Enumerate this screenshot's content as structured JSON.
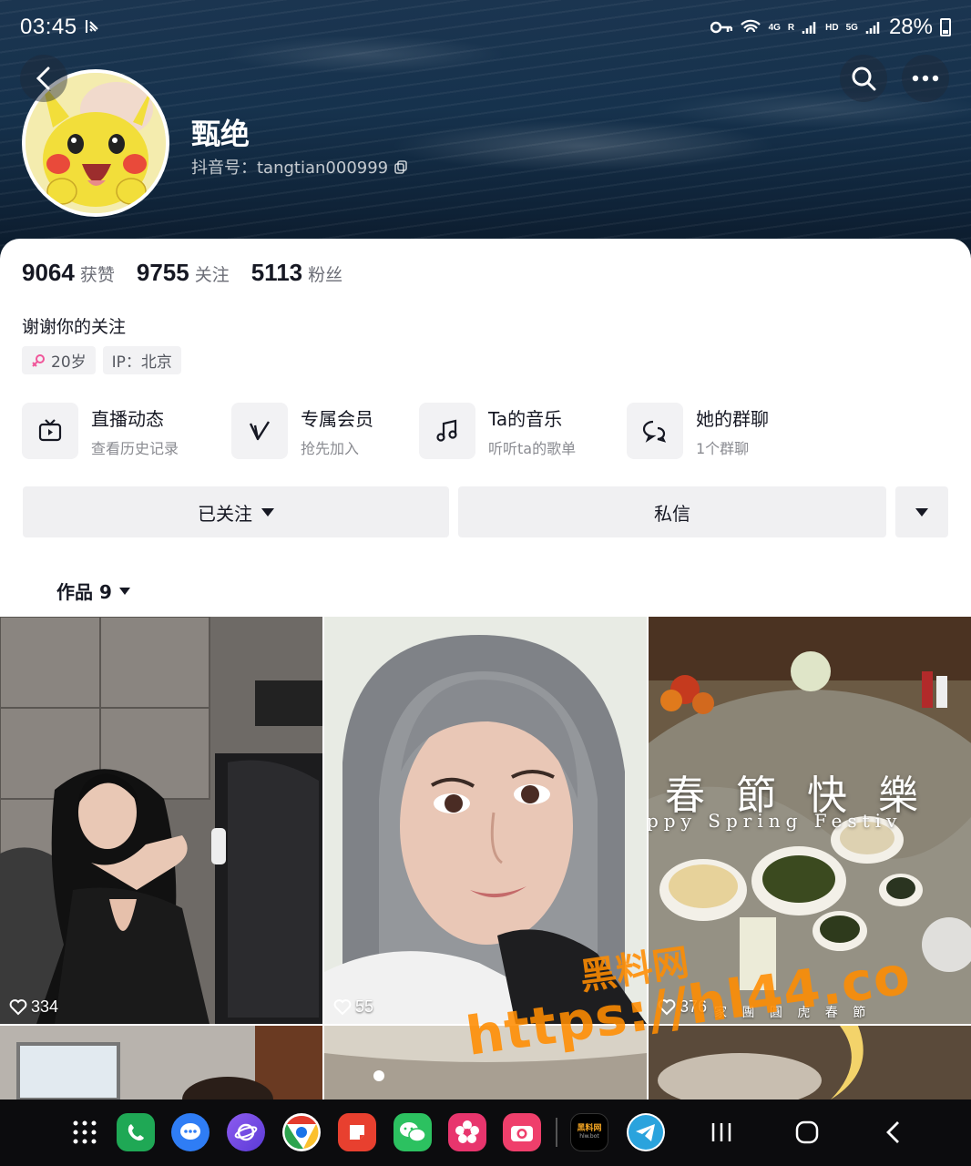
{
  "status_bar": {
    "time": "03:45",
    "network_4g": "4G",
    "roaming": "R",
    "hd": "HD",
    "network_5g": "5G",
    "battery": "28%"
  },
  "profile": {
    "nickname": "甄绝",
    "douyin_id": "抖音号：tangtian000999",
    "bio": "谢谢你的关注",
    "tags": [
      {
        "icon": "female-icon",
        "label": "20岁"
      },
      {
        "label": "IP：北京"
      }
    ]
  },
  "stats": [
    {
      "num": "9064",
      "label": "获赞"
    },
    {
      "num": "9755",
      "label": "关注"
    },
    {
      "num": "5113",
      "label": "粉丝"
    }
  ],
  "features": [
    {
      "icon": "live-tv-icon",
      "title": "直播动态",
      "sub": "查看历史记录"
    },
    {
      "icon": "vip-v-icon",
      "title": "专属会员",
      "sub": "抢先加入"
    },
    {
      "icon": "music-note-icon",
      "title": "Ta的音乐",
      "sub": "听听ta的歌单"
    },
    {
      "icon": "group-chat-icon",
      "title": "她的群聊",
      "sub": "1个群聊"
    }
  ],
  "actions": {
    "followed": "已关注",
    "message": "私信"
  },
  "works_tab": "作品 9",
  "videos": [
    {
      "likes": "334"
    },
    {
      "likes": "55"
    },
    {
      "likes": "376",
      "overlay_title": "春 節 快 樂",
      "overlay_sub": "ppy Spring Festiv",
      "overlay_bottom": "家 團 圓 虎 春 節"
    }
  ],
  "watermark": {
    "line1": "黑料网",
    "line2": "https://hl44.co"
  },
  "dock": {
    "apps": [
      "apps-grid-icon",
      "phone-icon",
      "messages-icon",
      "internet-icon",
      "chrome-icon",
      "notes-icon",
      "wechat-icon",
      "flower-icon",
      "camera-icon",
      "heiliao-icon",
      "telegram-icon"
    ],
    "heiliao_label": "黑料网",
    "heiliao_sub": "hlw.bot"
  },
  "colors": {
    "primary_text": "#161823",
    "secondary_text": "#6b6d76",
    "button_bg": "#f0f0f2",
    "watermark": "#ff8c00"
  }
}
